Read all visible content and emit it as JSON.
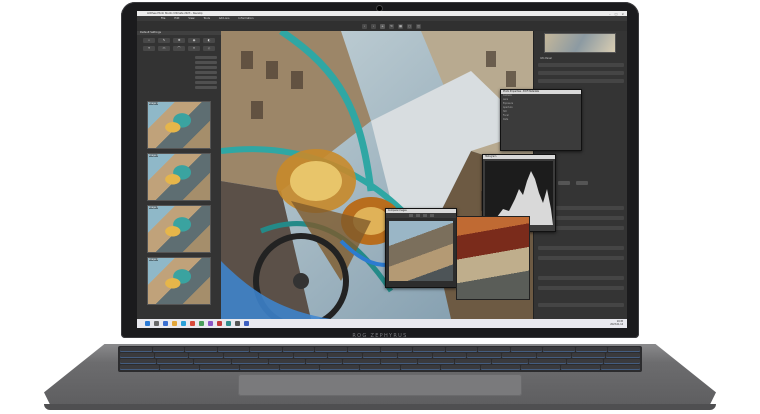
{
  "device": {
    "brand_label": "ROG ZEPHYRUS"
  },
  "app": {
    "window_title": "ACDSee Photo Studio Ultimate 2023 - Develop",
    "menu": [
      "File",
      "Edit",
      "View",
      "Tools",
      "Add-ons",
      "Information"
    ],
    "left_panel_title": "Default Settings",
    "thumb_labels": [
      "Image 1",
      "Image 2",
      "Image 3",
      "Image 4",
      "Image 5"
    ],
    "right_panel_title": "Info Panel",
    "metadata_title": "Photo Properties - EXIF Metadata",
    "metadata_rows": [
      {
        "k": "Camera",
        "v": ""
      },
      {
        "k": "Lens",
        "v": ""
      },
      {
        "k": "Exposure",
        "v": ""
      },
      {
        "k": "Aperture",
        "v": ""
      },
      {
        "k": "ISO",
        "v": ""
      },
      {
        "k": "Focal",
        "v": ""
      },
      {
        "k": "Date",
        "v": ""
      }
    ],
    "histogram_title": "Histogram",
    "compare_title": "Compare Images"
  },
  "taskbar": {
    "time": "10:45",
    "date": "2023-01-14"
  },
  "colors": {
    "accent_teal": "#2fa7a4",
    "histogram_fill": "#d9d9d9",
    "taskbar_bg": "#e9e9ee"
  }
}
